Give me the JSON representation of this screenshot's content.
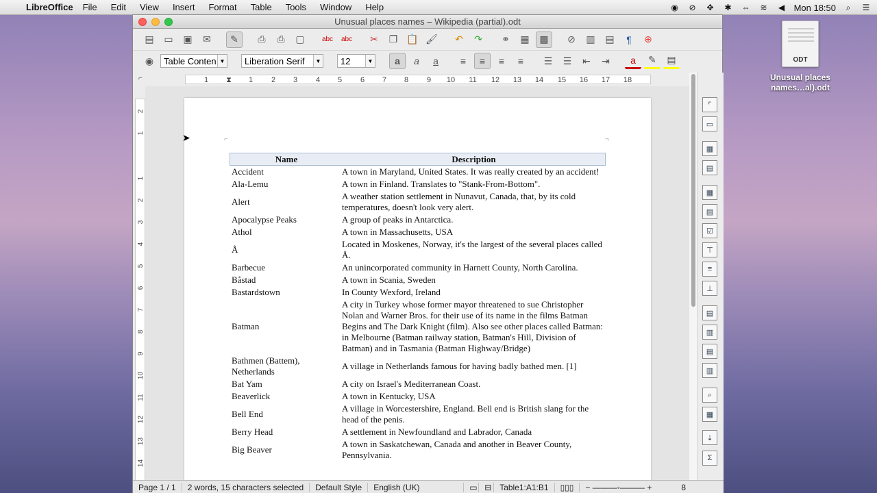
{
  "menubar": {
    "app_name": "LibreOffice",
    "items": [
      "File",
      "Edit",
      "View",
      "Insert",
      "Format",
      "Table",
      "Tools",
      "Window",
      "Help"
    ],
    "clock": "Mon 18:50"
  },
  "desktop": {
    "file_icon_ext": "ODT",
    "file_label_line1": "Unusual places",
    "file_label_line2": "names…al).odt"
  },
  "window": {
    "title": "Unusual places names – Wikipedia (partial).odt"
  },
  "formatting": {
    "paragraph_style": "Table Conten",
    "font_name": "Liberation Serif",
    "font_size": "12"
  },
  "ruler": {
    "ticks": [
      "1",
      "1",
      "1",
      "2",
      "3",
      "4",
      "5",
      "6",
      "7",
      "8",
      "9",
      "10",
      "11",
      "12",
      "13",
      "14",
      "15",
      "16",
      "17",
      "18"
    ],
    "vticks": [
      "2",
      "1",
      "1",
      "2",
      "3",
      "4",
      "5",
      "6",
      "7",
      "8",
      "9",
      "10",
      "11",
      "12",
      "13",
      "14"
    ]
  },
  "table": {
    "headers": {
      "name": "Name",
      "description": "Description"
    },
    "rows": [
      {
        "name": "Accident",
        "description": "A town in Maryland, United States. It was really created by an accident!"
      },
      {
        "name": "Ala-Lemu",
        "description": "A town in Finland. Translates to \"Stank-From-Bottom\"."
      },
      {
        "name": "Alert",
        "description": "A weather station settlement in Nunavut, Canada, that, by its cold temperatures, doesn't look very alert."
      },
      {
        "name": "Apocalypse Peaks",
        "description": "A group of peaks in Antarctica."
      },
      {
        "name": "Athol",
        "description": "A town in Massachusetts, USA"
      },
      {
        "name": "Å",
        "description": "Located in Moskenes, Norway, it's the largest of the several places called Å."
      },
      {
        "name": "Barbecue",
        "description": "An unincorporated community in Harnett County, North Carolina."
      },
      {
        "name": "Båstad",
        "description": "A town in Scania, Sweden"
      },
      {
        "name": "Bastardstown",
        "description": "In County Wexford, Ireland"
      },
      {
        "name": "Batman",
        "description": "A city in Turkey whose former mayor threatened to sue Christopher Nolan and Warner Bros. for their use of its name in the films Batman Begins and The Dark Knight (film). Also see other places called Batman: in Melbourne (Batman railway station, Batman's Hill, Division of Batman) and in Tasmania (Batman Highway/Bridge)"
      },
      {
        "name": "Bathmen (Battem), Netherlands",
        "description": "A village in Netherlands famous for having badly bathed men. [1]"
      },
      {
        "name": "Bat Yam",
        "description": "A city on Israel's Mediterranean Coast."
      },
      {
        "name": "Beaverlick",
        "description": "A town in Kentucky, USA"
      },
      {
        "name": "Bell End",
        "description": "A village in Worcestershire, England. Bell end is British slang for the head of the penis."
      },
      {
        "name": "Berry Head",
        "description": "A settlement in Newfoundland and Labrador, Canada"
      },
      {
        "name": "Big Beaver",
        "description": "A town in Saskatchewan, Canada and another in Beaver County, Pennsylvania."
      }
    ]
  },
  "status": {
    "page": "Page 1 / 1",
    "selection": "2 words, 15 characters selected",
    "style": "Default Style",
    "language": "English (UK)",
    "cell": "Table1:A1:B1",
    "zoom_digit": "8"
  }
}
